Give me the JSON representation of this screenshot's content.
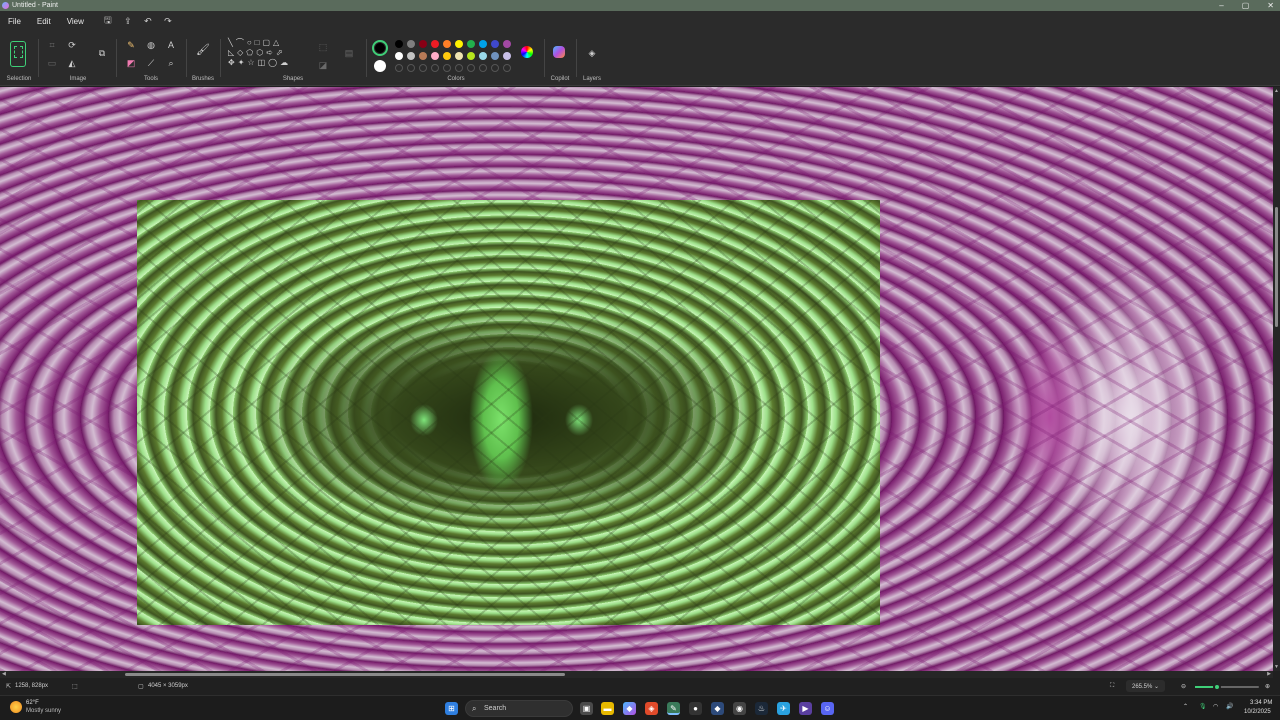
{
  "window": {
    "title": "Untitled - Paint",
    "controls": [
      "–",
      "▢",
      "✕"
    ]
  },
  "menu": {
    "items": [
      "File",
      "Edit",
      "View"
    ]
  },
  "ribbon": {
    "groups": {
      "selection": "Selection",
      "image": "Image",
      "tools": "Tools",
      "brushes": "Brushes",
      "shapes": "Shapes",
      "colors": "Colors",
      "copilot": "Copilot",
      "layers": "Layers"
    },
    "palette_row1": [
      "#000000",
      "#7f7f7f",
      "#880015",
      "#ed1c24",
      "#ff7f27",
      "#fff200",
      "#22b14c",
      "#00a2e8",
      "#3f48cc",
      "#a349a4"
    ],
    "palette_row2": [
      "#ffffff",
      "#c3c3c3",
      "#b97a57",
      "#ffaec9",
      "#ffc90e",
      "#efe4b0",
      "#b5e61d",
      "#99d9ea",
      "#7092be",
      "#c8bfe7"
    ],
    "accent": "#3fcf78"
  },
  "status": {
    "cursor_pos": "1258, 828px",
    "image_size": "4045 × 3059px",
    "zoom": "265.5%",
    "zoom_level_fraction": 0.34
  },
  "taskbar": {
    "weather_temp": "62°F",
    "weather_desc": "Mostly sunny",
    "search_label": "Search",
    "time": "3:34 PM",
    "date": "10/2/2025"
  }
}
